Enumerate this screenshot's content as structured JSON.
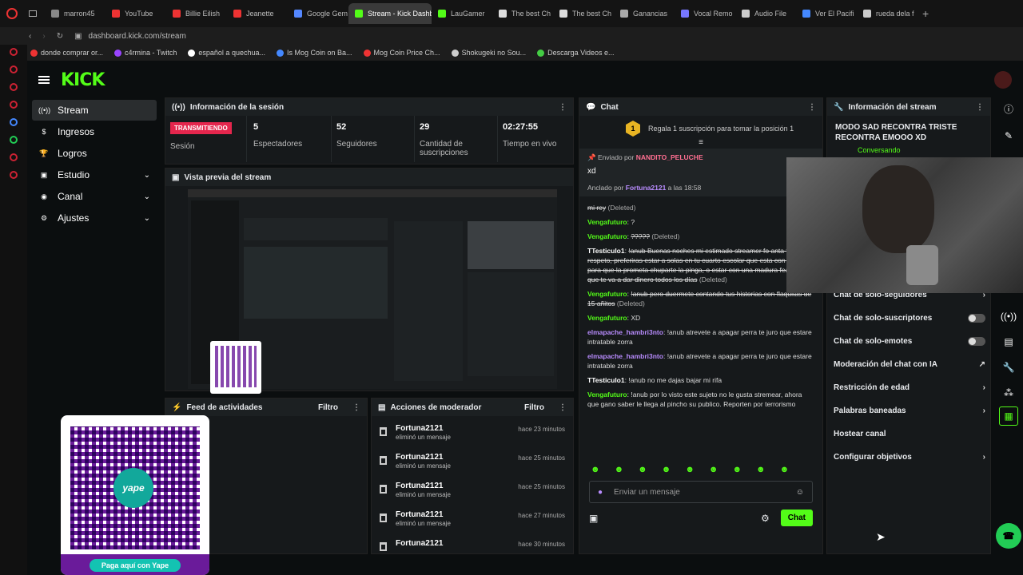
{
  "browser": {
    "tabs": [
      {
        "label": "marron45",
        "color": "#888"
      },
      {
        "label": "YouTube",
        "color": "#e33"
      },
      {
        "label": "Billie Eilish",
        "color": "#e33"
      },
      {
        "label": "Jeanette",
        "color": "#e33"
      },
      {
        "label": "Google Gem",
        "color": "#58f"
      },
      {
        "label": "Stream - Kick Dashbo",
        "color": "#53fc18"
      },
      {
        "label": "LauGamer",
        "color": "#53fc18"
      },
      {
        "label": "The best Ch",
        "color": "#ddd"
      },
      {
        "label": "The best Ch",
        "color": "#ddd"
      },
      {
        "label": "Ganancias",
        "color": "#aaa"
      },
      {
        "label": "Vocal Remo",
        "color": "#77f"
      },
      {
        "label": "Audio File",
        "color": "#ccc"
      },
      {
        "label": "Ver El Pacifi",
        "color": "#48f"
      },
      {
        "label": "rueda dela f",
        "color": "#ccc"
      }
    ],
    "url": "dashboard.kick.com/stream",
    "bookmarks": [
      {
        "label": "donde comprar or...",
        "color": "#e33"
      },
      {
        "label": "c4rmina - Twitch",
        "color": "#94f"
      },
      {
        "label": "español a quechua...",
        "color": "#fff"
      },
      {
        "label": "Is Mog Coin on Ba...",
        "color": "#48f"
      },
      {
        "label": "Mog Coin Price Ch...",
        "color": "#e33"
      },
      {
        "label": "Shokugeki no Sou...",
        "color": "#ccc"
      },
      {
        "label": "Descarga Videos e...",
        "color": "#4c4"
      }
    ]
  },
  "app": {
    "logo": "KICK",
    "nav": [
      {
        "label": "Stream",
        "icon": "broadcast-icon"
      },
      {
        "label": "Ingresos",
        "icon": "money-icon"
      },
      {
        "label": "Logros",
        "icon": "trophy-icon"
      },
      {
        "label": "Estudio",
        "icon": "studio-icon",
        "expand": "⌄"
      },
      {
        "label": "Canal",
        "icon": "channel-icon",
        "expand": "⌄"
      },
      {
        "label": "Ajustes",
        "icon": "gear-icon",
        "expand": "⌄"
      }
    ]
  },
  "session": {
    "title": "Información de la sesión",
    "badge": "TRANSMITIENDO",
    "badge_label": "Sesión",
    "stats": [
      {
        "value": "5",
        "label": "Espectadores"
      },
      {
        "value": "52",
        "label": "Seguidores"
      },
      {
        "value": "29",
        "label": "Cantidad de suscripciones"
      },
      {
        "value": "02:27:55",
        "label": "Tiempo en vivo"
      }
    ]
  },
  "preview": {
    "title": "Vista previa del stream"
  },
  "activity": {
    "title": "Feed de actividades",
    "filter": "Filtro"
  },
  "moderator": {
    "title": "Acciones de moderador",
    "filter": "Filtro",
    "items": [
      {
        "user": "Fortuna2121",
        "action": "eliminó un mensaje",
        "time": "hace 23 minutos"
      },
      {
        "user": "Fortuna2121",
        "action": "eliminó un mensaje",
        "time": "hace 25 minutos"
      },
      {
        "user": "Fortuna2121",
        "action": "eliminó un mensaje",
        "time": "hace 25 minutos"
      },
      {
        "user": "Fortuna2121",
        "action": "eliminó un mensaje",
        "time": "hace 27 minutos"
      },
      {
        "user": "Fortuna2121",
        "action": "",
        "time": "hace 30 minutos"
      }
    ]
  },
  "chat": {
    "title": "Chat",
    "promo": "Regala 1 suscripción para tomar la posición 1",
    "promo_rank": "1",
    "pinned_by_prefix": "Enviado por",
    "pinned_sender": "NANDITO_PELUCHE",
    "pinned_text": "xd",
    "anchored_prefix": "Anclado por",
    "anchored_by": "Fortuna2121",
    "anchored_time": "a las 18:58",
    "messages": [
      {
        "user": "",
        "text": "mi rey",
        "deleted": "(Deleted)",
        "color": "#ddd"
      },
      {
        "user": "Vengafuturo",
        "text": "?",
        "deleted": "",
        "color": "#53fc18"
      },
      {
        "user": "Vengafuturo",
        "text": "?????",
        "deleted": "(Deleted)",
        "color": "#53fc18"
      },
      {
        "user": "TTesticulo1",
        "text": "!anub Buenas noches mi estimado streamer fo anta todo con respeto, preferiras estar a solas en tu cuarto escolar que esta con su regla para que la prometa chuparte la pinga, o estar con una madura fea para que te va a dar dinero todos los días",
        "deleted": "(Deleted)",
        "color": "#fff"
      },
      {
        "user": "Vengafuturo",
        "text": "!anub pero duermete contando tus historias con flaquitas de 15 añitos",
        "deleted": "(Deleted)",
        "color": "#53fc18"
      },
      {
        "user": "Vengafuturo",
        "text": "XD",
        "deleted": "",
        "color": "#53fc18"
      },
      {
        "user": "elmapache_hambri3nto",
        "text": "!anub atrevete a apagar perra te juro que estare intratable zorra",
        "deleted": "",
        "color": "#b98cff"
      },
      {
        "user": "elmapache_hambri3nto",
        "text": "!anub atrevete a apagar perra te juro que estare intratable zorra",
        "deleted": "",
        "color": "#b98cff"
      },
      {
        "user": "TTesticulo1",
        "text": "!anub no me dajas bajar mi rifa",
        "deleted": "",
        "color": "#fff"
      },
      {
        "user": "Vengafuturo",
        "text": "!anub por lo visto este sujeto no le gusta stremear, ahora que gano saber le llega al pincho su publico. Reporten por terrorismo",
        "deleted": "",
        "color": "#53fc18"
      }
    ],
    "input_placeholder": "Enviar un mensaje",
    "send": "Chat"
  },
  "stream_info": {
    "title": "Información del stream",
    "stream_title": "MODO SAD RECONTRA TRISTE RECONTRA EMOOO XD",
    "category": "Conversando",
    "settings": [
      {
        "label": "Chat de solo-seguidores",
        "control": "›"
      },
      {
        "label": "Chat de solo-suscriptores",
        "control": "toggle"
      },
      {
        "label": "Chat de solo-emotes",
        "control": "toggle"
      },
      {
        "label": "Moderación del chat con IA",
        "control": "↗"
      },
      {
        "label": "Restricción de edad",
        "control": "›"
      },
      {
        "label": "Palabras baneadas",
        "control": "›"
      },
      {
        "label": "Hostear canal",
        "control": ""
      },
      {
        "label": "Configurar objetivos",
        "control": "›"
      }
    ]
  },
  "qr": {
    "caption": "Paga aquí con Yape",
    "brand": "yape"
  }
}
